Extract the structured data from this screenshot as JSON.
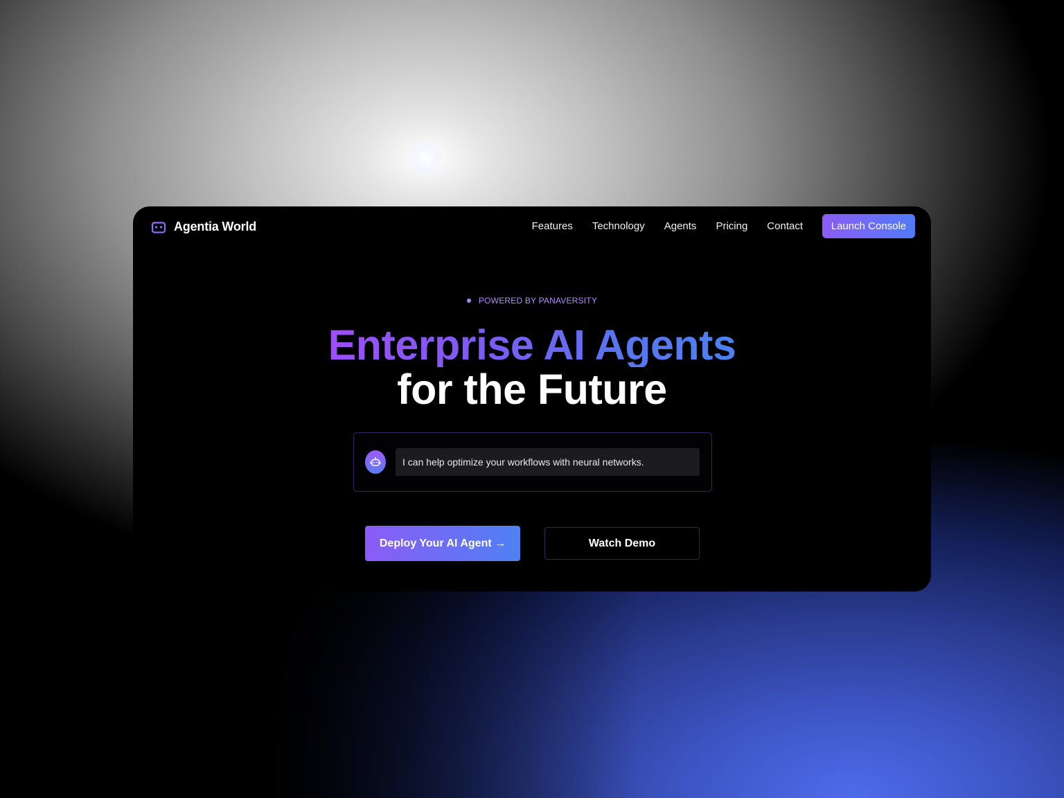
{
  "brand": {
    "name": "Agentia World",
    "icon": "robot-icon"
  },
  "nav": {
    "links": [
      "Features",
      "Technology",
      "Agents",
      "Pricing",
      "Contact"
    ],
    "cta_label": "Launch Console"
  },
  "hero": {
    "badge": "POWERED BY PANAVERSITY",
    "headline_line1": "Enterprise AI Agents",
    "headline_line2": "for the Future",
    "chat_message": "I can help optimize your workflows with neural networks.",
    "primary_cta": "Deploy Your AI Agent →",
    "secondary_cta": "Watch Demo"
  },
  "colors": {
    "accent_purple": "#8b5cf6",
    "accent_blue": "#4f7bf4",
    "window_bg": "#000000",
    "chat_bubble_bg": "#1c1c1e",
    "border": "#3b1f66"
  }
}
